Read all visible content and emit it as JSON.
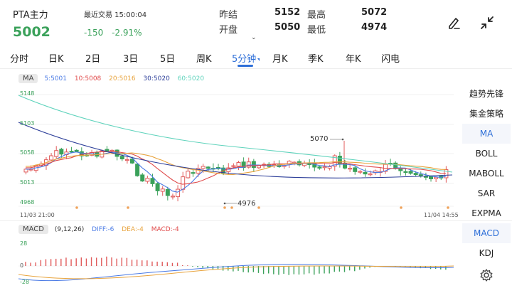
{
  "header": {
    "title": "PTA主力",
    "last_trade": "最近交易 15:00:04",
    "price": "5002",
    "change": "-150",
    "change_pct": "-2.91%",
    "prev_close_label": "昨结",
    "prev_close": "5152",
    "high_label": "最高",
    "high": "5072",
    "open_label": "开盘",
    "open": "5050",
    "low_label": "最低",
    "low": "4974",
    "collapse_glyph": "⌄",
    "icons": [
      "edit-pen-icon",
      "shrink-arrows-icon"
    ]
  },
  "tabs": [
    {
      "label": "分时"
    },
    {
      "label": "日K"
    },
    {
      "label": "2日"
    },
    {
      "label": "3日"
    },
    {
      "label": "5日"
    },
    {
      "label": "周K"
    },
    {
      "label": "5分钟",
      "active": true
    },
    {
      "label": "月K"
    },
    {
      "label": "季K"
    },
    {
      "label": "年K"
    },
    {
      "label": "闪电"
    }
  ],
  "ma_legend": {
    "badge": "MA",
    "items": [
      {
        "text": "5:5001",
        "color": "#4b7be5"
      },
      {
        "text": "10:5008",
        "color": "#e04b4b"
      },
      {
        "text": "20:5016",
        "color": "#e8a33c"
      },
      {
        "text": "30:5020",
        "color": "#2c3e99"
      },
      {
        "text": "60:5020",
        "color": "#5fd3bc"
      }
    ]
  },
  "price_axis": [
    "5148",
    "5103",
    "5058",
    "5013",
    "4968"
  ],
  "time_axis": {
    "start": "11/03 21:00",
    "end": "11/04 14:55"
  },
  "annotations": {
    "high": "5070",
    "low": "4976"
  },
  "macd_legend": {
    "badge": "MACD",
    "params": "(9,12,26)",
    "items": [
      {
        "text": "DIFF:-6",
        "color": "#4b7be5"
      },
      {
        "text": "DEA:-4",
        "color": "#e8a33c"
      },
      {
        "text": "MACD:-4",
        "color": "#e04b4b"
      }
    ]
  },
  "macd_axis": [
    "28",
    "0",
    "-28"
  ],
  "sidebar": [
    {
      "label": "趋势先锋"
    },
    {
      "label": "集金策略"
    },
    {
      "label": "MA",
      "active": true
    },
    {
      "label": "BOLL"
    },
    {
      "label": "MABOLL"
    },
    {
      "label": "SAR"
    },
    {
      "label": "EXPMA"
    },
    {
      "label": "MACD",
      "active": true
    },
    {
      "label": "KDJ"
    }
  ],
  "colors": {
    "up": "#e05b5b",
    "down": "#3aa15a",
    "accent": "#2e6fd8"
  }
}
